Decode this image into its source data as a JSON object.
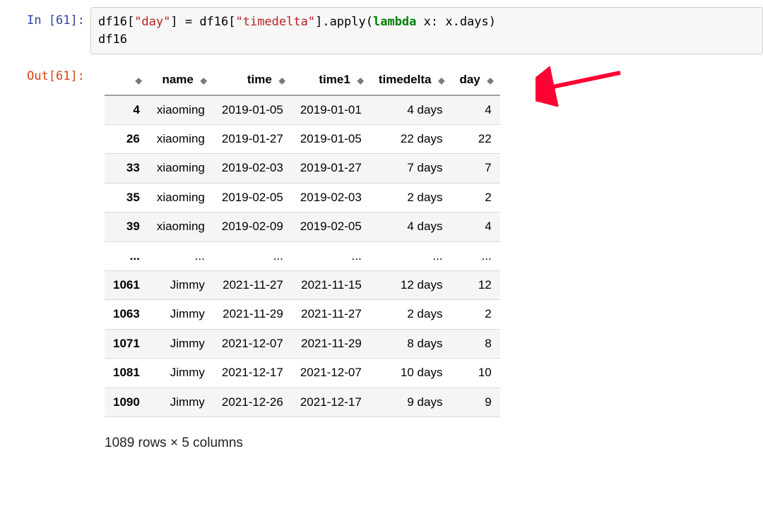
{
  "prompts": {
    "in_label": "In [61]:",
    "out_label": "Out[61]:"
  },
  "code": {
    "tokens": [
      {
        "cls": "tok-plain",
        "t": "df16["
      },
      {
        "cls": "tok-str",
        "t": "\"day\""
      },
      {
        "cls": "tok-plain",
        "t": "] = df16["
      },
      {
        "cls": "tok-str",
        "t": "\"timedelta\""
      },
      {
        "cls": "tok-plain",
        "t": "].apply("
      },
      {
        "cls": "tok-kw",
        "t": "lambda"
      },
      {
        "cls": "tok-plain",
        "t": " x: x.days)\ndf16"
      }
    ]
  },
  "table": {
    "columns": [
      "name",
      "time",
      "time1",
      "timedelta",
      "day"
    ],
    "rows": [
      {
        "idx": "4",
        "cells": [
          "xiaoming",
          "2019-01-05",
          "2019-01-01",
          "4 days",
          "4"
        ]
      },
      {
        "idx": "26",
        "cells": [
          "xiaoming",
          "2019-01-27",
          "2019-01-05",
          "22 days",
          "22"
        ]
      },
      {
        "idx": "33",
        "cells": [
          "xiaoming",
          "2019-02-03",
          "2019-01-27",
          "7 days",
          "7"
        ]
      },
      {
        "idx": "35",
        "cells": [
          "xiaoming",
          "2019-02-05",
          "2019-02-03",
          "2 days",
          "2"
        ]
      },
      {
        "idx": "39",
        "cells": [
          "xiaoming",
          "2019-02-09",
          "2019-02-05",
          "4 days",
          "4"
        ]
      },
      {
        "idx": "...",
        "cells": [
          "...",
          "...",
          "...",
          "...",
          "..."
        ]
      },
      {
        "idx": "1061",
        "cells": [
          "Jimmy",
          "2021-11-27",
          "2021-11-15",
          "12 days",
          "12"
        ]
      },
      {
        "idx": "1063",
        "cells": [
          "Jimmy",
          "2021-11-29",
          "2021-11-27",
          "2 days",
          "2"
        ]
      },
      {
        "idx": "1071",
        "cells": [
          "Jimmy",
          "2021-12-07",
          "2021-11-29",
          "8 days",
          "8"
        ]
      },
      {
        "idx": "1081",
        "cells": [
          "Jimmy",
          "2021-12-17",
          "2021-12-07",
          "10 days",
          "10"
        ]
      },
      {
        "idx": "1090",
        "cells": [
          "Jimmy",
          "2021-12-26",
          "2021-12-17",
          "9 days",
          "9"
        ]
      }
    ],
    "footer": "1089 rows × 5 columns"
  },
  "arrow": {
    "color": "#ff0033"
  }
}
